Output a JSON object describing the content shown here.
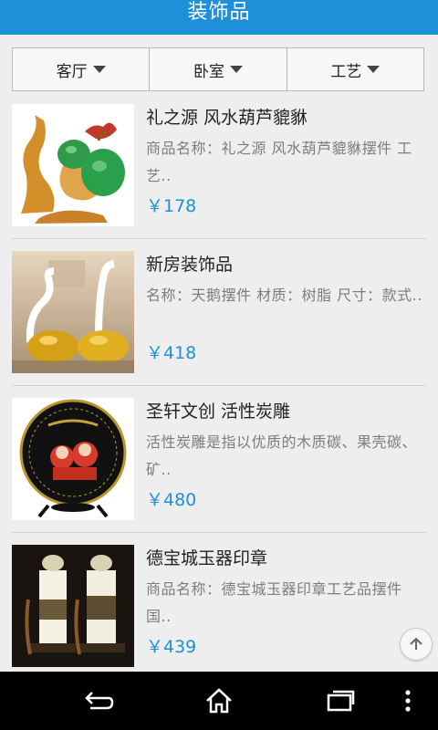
{
  "header": {
    "title": "装饰品"
  },
  "filters": [
    {
      "label": "客厅"
    },
    {
      "label": "卧室"
    },
    {
      "label": "工艺"
    }
  ],
  "products": [
    {
      "title": "礼之源 风水葫芦貔貅",
      "desc": "商品名称：礼之源 风水葫芦貔貅摆件 工艺..",
      "price": "￥178",
      "image": "green-gourd-figurine"
    },
    {
      "title": "新房装饰品",
      "desc": "名称：天鹅摆件 材质：树脂 尺寸：款式..",
      "price": "￥418",
      "image": "swan-pair-figurine"
    },
    {
      "title": "圣轩文创 活性炭雕",
      "desc": "活性炭雕是指以优质的木质碳、果壳碳、矿..",
      "price": "￥480",
      "image": "charcoal-plate-carving"
    },
    {
      "title": "德宝城玉器印章",
      "desc": "商品名称：德宝城玉器印章工艺品摆件 国..",
      "price": "￥439",
      "image": "jade-seal-pair"
    }
  ],
  "icons": {
    "dropdown": "triangle-down-icon",
    "scroll_top": "arrow-up-icon",
    "back": "back-icon",
    "home": "home-icon",
    "recents": "recents-icon",
    "menu": "overflow-menu-icon"
  },
  "colors": {
    "accent": "#1e8fd9",
    "background": "#eeeeee",
    "price": "#1e8fd9"
  }
}
